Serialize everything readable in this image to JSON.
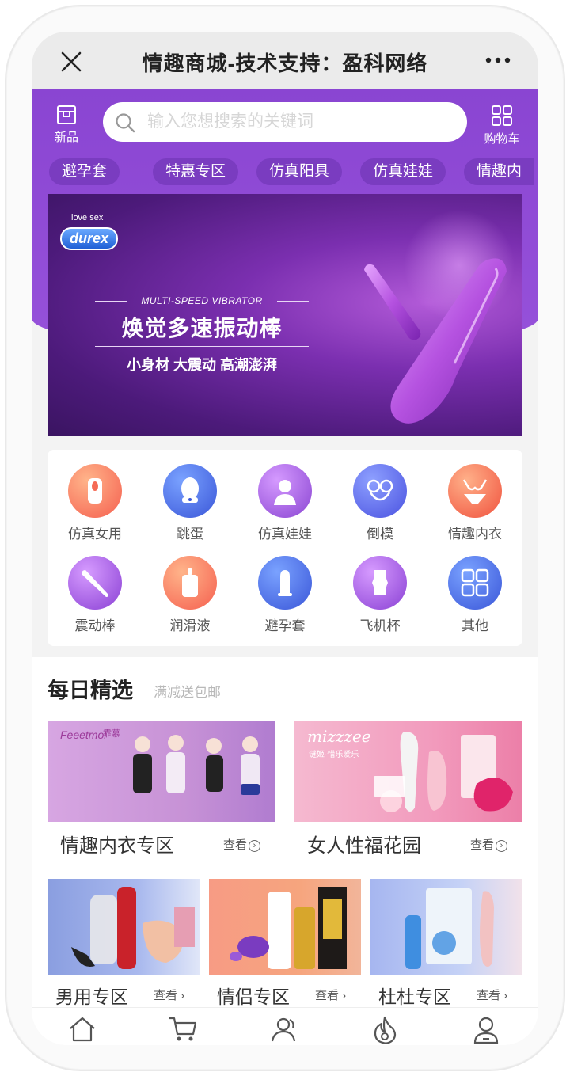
{
  "window": {
    "title": "情趣商城-技术支持：盈科网络",
    "close_icon": "close-icon",
    "more_icon": "more-icon"
  },
  "header": {
    "left_button": {
      "label": "新品",
      "icon": "new-product-icon"
    },
    "right_button": {
      "label": "购物车",
      "icon": "grid-cart-icon"
    },
    "search": {
      "placeholder": "输入您想搜索的关键词",
      "value": "",
      "icon": "search-icon"
    },
    "chips": [
      "避孕套",
      "特惠专区",
      "仿真阳具",
      "仿真娃娃",
      "情趣内"
    ]
  },
  "banner": {
    "brand_small": "love sex",
    "brand": "durex",
    "tagline": "MULTI-SPEED VIBRATOR",
    "headline": "焕觉多速振动棒",
    "sub": "小身材  大震动  高潮澎湃"
  },
  "categories": [
    {
      "label": "仿真女用",
      "icon": "female-toy-icon",
      "color": "#f87a5a"
    },
    {
      "label": "跳蛋",
      "icon": "egg-icon",
      "color": "#4a6ee8"
    },
    {
      "label": "仿真娃娃",
      "icon": "doll-icon",
      "color": "#a85ce0"
    },
    {
      "label": "倒模",
      "icon": "mold-icon",
      "color": "#5b6ff0"
    },
    {
      "label": "情趣内衣",
      "icon": "lingerie-icon",
      "color": "#f57254"
    },
    {
      "label": "震动棒",
      "icon": "vibrator-icon",
      "color": "#a35ee2"
    },
    {
      "label": "润滑液",
      "icon": "lubricant-icon",
      "color": "#f77a55"
    },
    {
      "label": "避孕套",
      "icon": "condom-icon",
      "color": "#4d6ded"
    },
    {
      "label": "飞机杯",
      "icon": "cup-icon",
      "color": "#a45ee3"
    },
    {
      "label": "其他",
      "icon": "other-grid-icon",
      "color": "#4f6cee"
    }
  ],
  "daily": {
    "title": "每日精选",
    "subtitle": "满减送包邮",
    "view_label": "查看",
    "big_cards": [
      {
        "name": "情趣内衣专区",
        "logo": "Feeetmoi",
        "logo_cn": "霏慕",
        "bg": "#c9a0d8"
      },
      {
        "name": "女人性福花园",
        "logo": "mizzzee",
        "logo_cn": "谜姬·惜乐爱乐",
        "bg": "#f2a8c6"
      }
    ],
    "small_cards": [
      {
        "name": "男用专区",
        "bg": "#8fa3e0"
      },
      {
        "name": "情侣专区",
        "bg": "#f4a07a"
      },
      {
        "name": "杜杜专区",
        "bg": "#b6c8f2"
      }
    ]
  },
  "tabbar": [
    "home-icon",
    "cart-icon",
    "users-icon",
    "fire-icon",
    "profile-icon"
  ]
}
